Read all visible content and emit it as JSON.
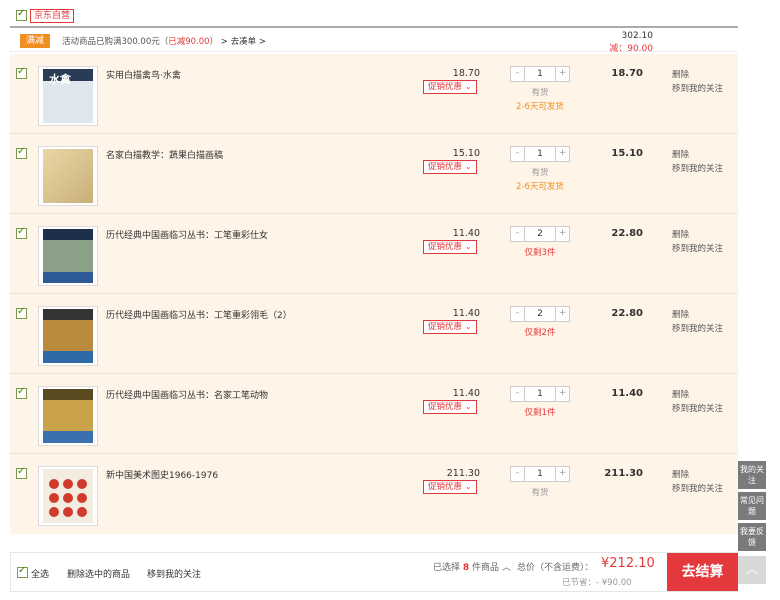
{
  "shop": {
    "name": "京东自营"
  },
  "promo": {
    "tag": "满减",
    "text_prefix": "活动商品已购满300.00元（",
    "saved_text": "已减90.00",
    "text_suffix": "）",
    "link": " > 去凑单 >",
    "group_total": "302.10",
    "group_saved": "减：90.00"
  },
  "items": [
    {
      "title": "实用白描禽鸟·水禽",
      "price": "18.70",
      "promo": "促销优惠",
      "qty": "1",
      "stock": "有货",
      "ship": "2-6天可发货",
      "subtotal": "18.70",
      "cover_text": "水禽"
    },
    {
      "title": "名家白描教学：蔬果白描画稿",
      "price": "15.10",
      "promo": "促销优惠",
      "qty": "1",
      "stock": "有货",
      "ship": "2-6天可发货",
      "subtotal": "15.10"
    },
    {
      "title": "历代经典中国画临习丛书：工笔重彩仕女",
      "price": "11.40",
      "promo": "促销优惠",
      "qty": "2",
      "stock": "仅剩3件",
      "subtotal": "22.80"
    },
    {
      "title": "历代经典中国画临习丛书：工笔重彩翎毛（2）",
      "price": "11.40",
      "promo": "促销优惠",
      "qty": "2",
      "stock": "仅剩2件",
      "subtotal": "22.80"
    },
    {
      "title": "历代经典中国画临习丛书：名家工笔动物",
      "price": "11.40",
      "promo": "促销优惠",
      "qty": "1",
      "stock": "仅剩1件",
      "subtotal": "11.40"
    },
    {
      "title": "新中国美术图史1966-1976",
      "price": "211.30",
      "promo": "促销优惠",
      "qty": "1",
      "stock": "有货",
      "subtotal": "211.30"
    }
  ],
  "ops": {
    "delete": "删除",
    "move_to_fav": "移到我的关注"
  },
  "qty_controls": {
    "minus": "-",
    "plus": "+"
  },
  "footer": {
    "select_all": "全选",
    "delete_selected": "删除选中的商品",
    "move_to_fav": "移到我的关注",
    "selected_prefix": "已选择",
    "selected_count": "8",
    "selected_suffix": "件商品 ︿",
    "total_label": "总价（不含运费）：",
    "total_value": "¥212.10",
    "saved": "已节省：- ¥90.00",
    "checkout": "去结算"
  },
  "side": {
    "follow": "我的关注",
    "faq": "常见问题",
    "feedback": "我要反馈",
    "top": "︿"
  },
  "colors": {
    "accent": "#e4393c",
    "promo_tag": "#f08e24",
    "item_bg": "#fff4e8"
  }
}
